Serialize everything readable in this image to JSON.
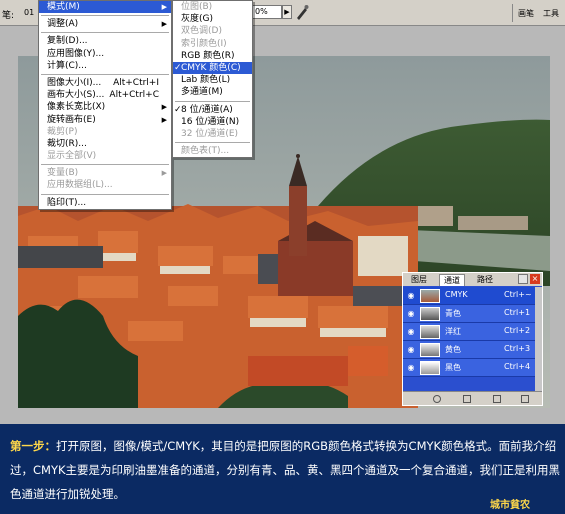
{
  "toolbar": {
    "left_label": "笔:",
    "left_number": "01",
    "zoom_value": "0%",
    "right_tabs": [
      "画笔",
      "工具"
    ]
  },
  "main_menu": {
    "items": [
      {
        "label": "模式(M)",
        "shortcut": "",
        "submenu": true,
        "disabled": false,
        "highlighted": true
      },
      {
        "sep": true
      },
      {
        "label": "调整(A)",
        "shortcut": "",
        "submenu": true,
        "disabled": false
      },
      {
        "sep": true
      },
      {
        "label": "复制(D)...",
        "shortcut": "",
        "submenu": false,
        "disabled": false
      },
      {
        "label": "应用图像(Y)...",
        "shortcut": "",
        "submenu": false,
        "disabled": false
      },
      {
        "label": "计算(C)...",
        "shortcut": "",
        "submenu": false,
        "disabled": false
      },
      {
        "sep": true
      },
      {
        "label": "图像大小(I)...",
        "shortcut": "Alt+Ctrl+I",
        "submenu": false,
        "disabled": false
      },
      {
        "label": "画布大小(S)...",
        "shortcut": "Alt+Ctrl+C",
        "submenu": false,
        "disabled": false
      },
      {
        "label": "像素长宽比(X)",
        "shortcut": "",
        "submenu": true,
        "disabled": false
      },
      {
        "label": "旋转画布(E)",
        "shortcut": "",
        "submenu": true,
        "disabled": false
      },
      {
        "label": "裁剪(P)",
        "shortcut": "",
        "submenu": false,
        "disabled": true
      },
      {
        "label": "裁切(R)...",
        "shortcut": "",
        "submenu": false,
        "disabled": false
      },
      {
        "label": "显示全部(V)",
        "shortcut": "",
        "submenu": false,
        "disabled": true
      },
      {
        "sep": true
      },
      {
        "label": "变量(B)",
        "shortcut": "",
        "submenu": true,
        "disabled": true
      },
      {
        "label": "应用数据组(L)...",
        "shortcut": "",
        "submenu": false,
        "disabled": true
      },
      {
        "sep": true
      },
      {
        "label": "陷印(T)...",
        "shortcut": "",
        "submenu": false,
        "disabled": false
      }
    ]
  },
  "mode_submenu": {
    "items": [
      {
        "label": "位图(B)",
        "disabled": true
      },
      {
        "label": "灰度(G)",
        "disabled": false
      },
      {
        "label": "双色调(D)",
        "disabled": true
      },
      {
        "label": "索引颜色(I)",
        "disabled": true
      },
      {
        "label": "RGB 颜色(R)",
        "disabled": false
      },
      {
        "label": "CMYK 颜色(C)",
        "disabled": false,
        "checked": true,
        "highlighted": true
      },
      {
        "label": "Lab 颜色(L)",
        "disabled": false
      },
      {
        "label": "多通道(M)",
        "disabled": false
      },
      {
        "sep": true
      },
      {
        "label": "8 位/通道(A)",
        "disabled": false,
        "checked": true
      },
      {
        "label": "16 位/通道(N)",
        "disabled": false
      },
      {
        "label": "32 位/通道(E)",
        "disabled": true
      },
      {
        "sep": true
      },
      {
        "label": "颜色表(T)...",
        "disabled": true
      }
    ]
  },
  "channels_panel": {
    "tabs": [
      "图层",
      "通道",
      "路径"
    ],
    "active_tab": 1,
    "channels": [
      {
        "name": "CMYK",
        "shortcut": "Ctrl+~"
      },
      {
        "name": "青色",
        "shortcut": "Ctrl+1"
      },
      {
        "name": "洋红",
        "shortcut": "Ctrl+2"
      },
      {
        "name": "黄色",
        "shortcut": "Ctrl+3"
      },
      {
        "name": "黑色",
        "shortcut": "Ctrl+4"
      }
    ]
  },
  "caption": {
    "step_label": "第一步：",
    "text": "打开原图，图像/模式/CMYK，其目的是把原图的RGB颜色格式转换为CMYK颜色格式。面前我介绍过，CMYK主要是为印刷油墨准备的通道，分别有青、品、黄、黑四个通道及一个复合通道，我们正是利用黑色通道进行加锐处理。",
    "signature": "城市貧农"
  },
  "colors": {
    "page_background": "#0b2a63",
    "menu_highlight": "#2c5ad4",
    "panel_blue": "#2b4fcf",
    "caption_accent": "#ffd84a"
  }
}
